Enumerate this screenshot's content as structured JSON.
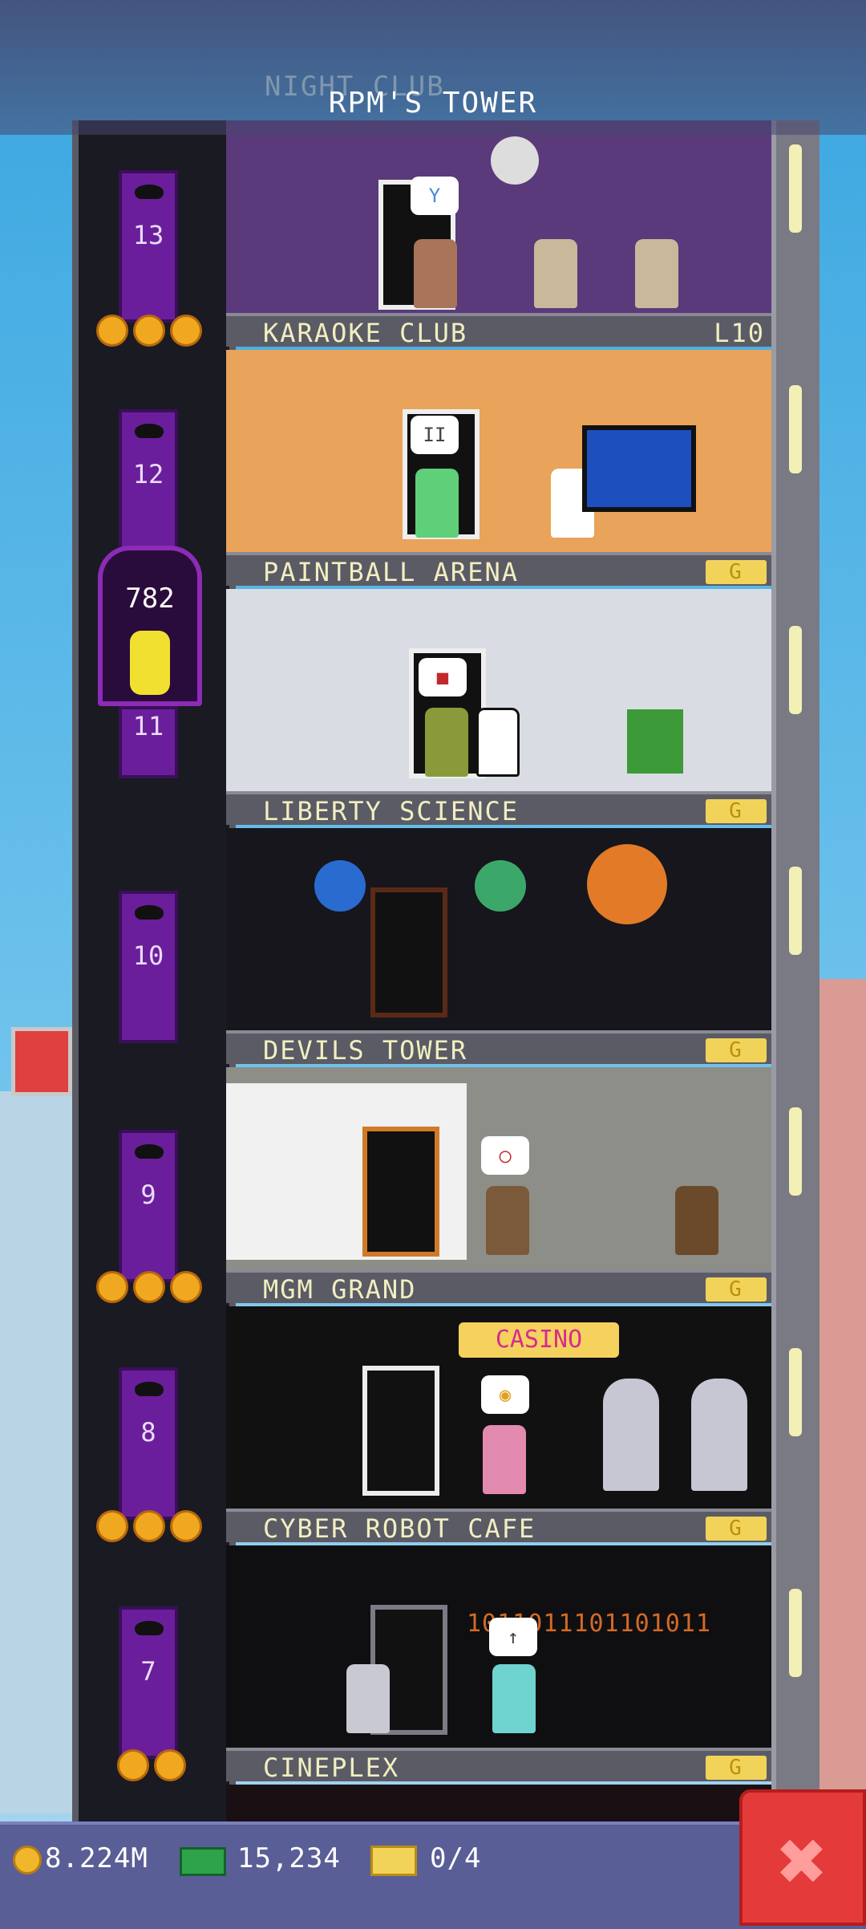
{
  "tower": {
    "name": "RPM'S TOWER",
    "top_floor_partial": "NIGHT CLUB"
  },
  "floors": [
    {
      "name": "KARAOKE CLUB",
      "tag": "L10",
      "elevator": "13",
      "bubble": "Y"
    },
    {
      "name": "PAINTBALL ARENA",
      "tag": "G",
      "elevator": "12",
      "bubble": "II"
    },
    {
      "name": "LIBERTY SCIENCE",
      "tag": "G",
      "elevator": "11",
      "bubble": "■"
    },
    {
      "name": "DEVILS TOWER",
      "tag": "G",
      "elevator": "10",
      "bubble": ""
    },
    {
      "name": "MGM GRAND",
      "tag": "G",
      "elevator": "9",
      "bubble": "◯"
    },
    {
      "name": "CYBER ROBOT CAFE",
      "tag": "G",
      "elevator": "8",
      "bubble": "◉"
    },
    {
      "name": "CINEPLEX",
      "tag": "G",
      "elevator": "7",
      "bubble": "↑"
    }
  ],
  "casino_sign": "CASINO",
  "binary_text": "1011011101101011",
  "elevator_car": {
    "counter": "782"
  },
  "resources": {
    "coins": "8.224M",
    "bux": "15,234",
    "tickets": "0/4"
  },
  "icons": {
    "coin": "coin-icon",
    "bux": "bux-icon",
    "ticket": "ticket-icon",
    "close": "close-icon"
  },
  "close_symbol": "✖",
  "colors": {
    "tag_gold": "#f2d35a",
    "close_red": "#e53a3a",
    "elevator_purple": "#6b1e9c"
  }
}
